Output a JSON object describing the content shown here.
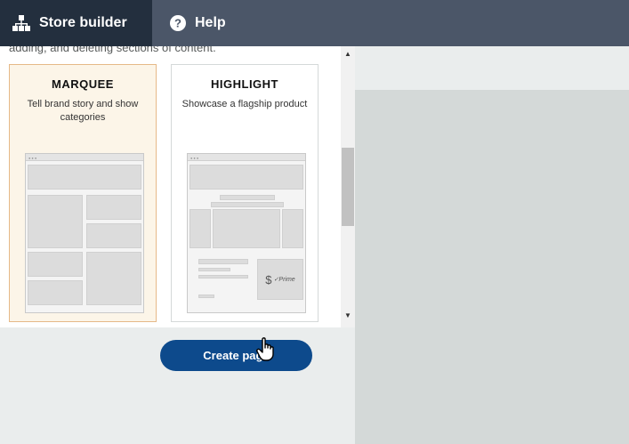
{
  "topbar": {
    "store_builder_label": "Store builder",
    "help_label": "Help",
    "store_icon": "sitemap-icon",
    "help_icon": "question-circle-icon"
  },
  "panel": {
    "intro_text": "adding, and deleting sections of content.",
    "templates": [
      {
        "title": "MARQUEE",
        "description": "Tell brand story and show categories",
        "selected": true
      },
      {
        "title": "HIGHLIGHT",
        "description": "Showcase a flagship product",
        "selected": false,
        "price_symbol": "$",
        "badge": "✓Prime"
      }
    ],
    "create_button_label": "Create page"
  },
  "colors": {
    "topbar": "#4b5668",
    "topbar_active": "#232f3e",
    "selected_card": "#fcf5e8",
    "selected_border": "#e6b988",
    "button": "#0d4a8c"
  }
}
